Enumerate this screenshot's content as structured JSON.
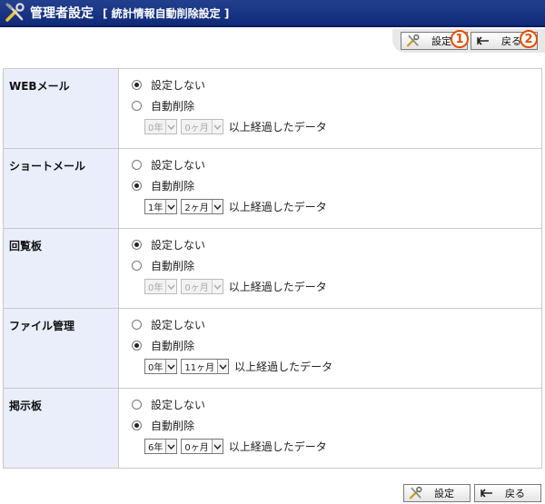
{
  "header": {
    "title": "管理者設定",
    "subtitle": "[ 統計情報自動削除設定 ]"
  },
  "toolbar": {
    "settings_label": "設定",
    "back_label": "戻る",
    "badge_1": "1",
    "badge_2": "2"
  },
  "options": {
    "none_label": "設定しない",
    "auto_label": "自動削除",
    "suffix": "以上経過したデータ"
  },
  "rows": [
    {
      "label": "WEBメール",
      "selected": "none",
      "year": "0年",
      "month": "0ヶ月",
      "disabled": true
    },
    {
      "label": "ショートメール",
      "selected": "auto",
      "year": "1年",
      "month": "2ヶ月",
      "disabled": false
    },
    {
      "label": "回覧板",
      "selected": "none",
      "year": "0年",
      "month": "0ヶ月",
      "disabled": true
    },
    {
      "label": "ファイル管理",
      "selected": "auto",
      "year": "0年",
      "month": "11ヶ月",
      "disabled": false
    },
    {
      "label": "掲示板",
      "selected": "auto",
      "year": "6年",
      "month": "0ヶ月",
      "disabled": false
    }
  ],
  "colors": {
    "header_bg": "#1a3583",
    "label_bg": "#eaeefa",
    "badge": "#e44d00"
  },
  "icons": [
    "tools-icon",
    "back-arrow-icon",
    "chevron-down-icon"
  ]
}
